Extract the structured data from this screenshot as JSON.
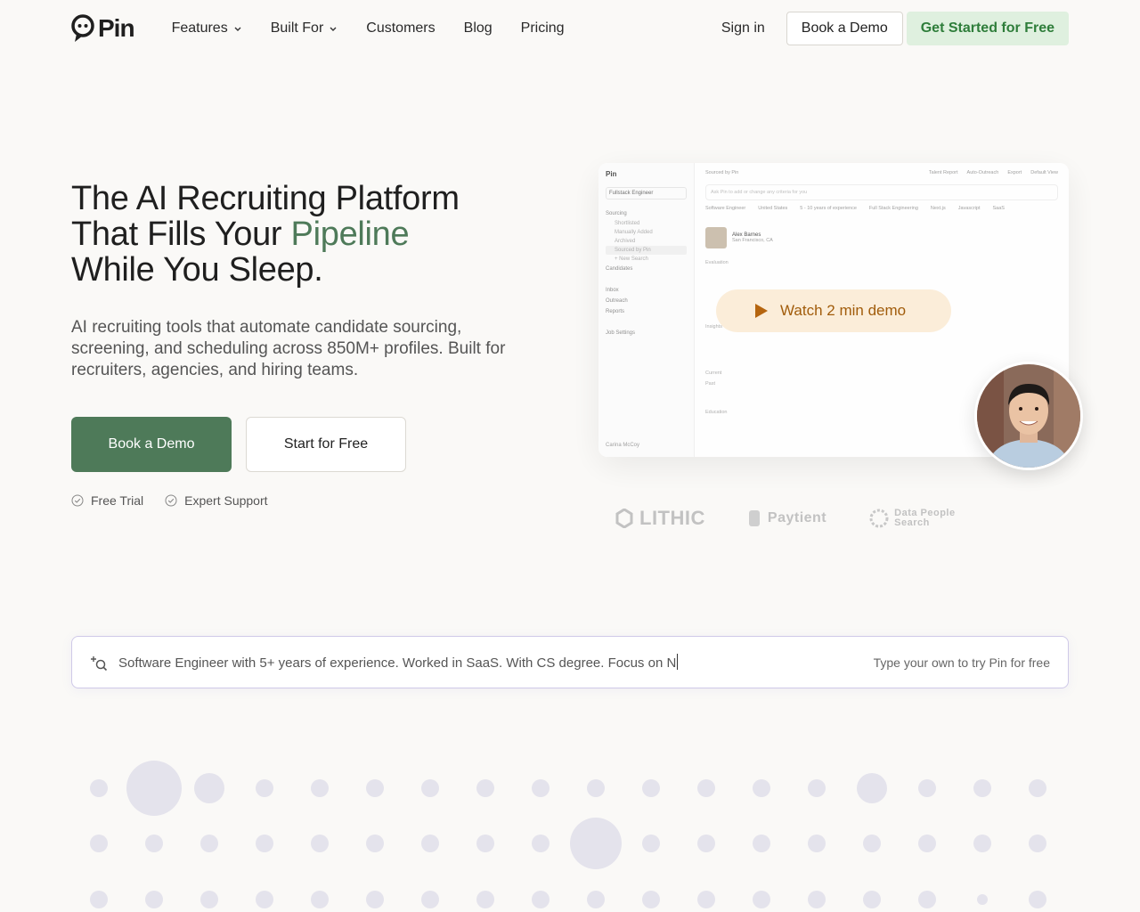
{
  "nav": {
    "logo_text": "Pin",
    "links": [
      "Features",
      "Built For",
      "Customers",
      "Blog",
      "Pricing"
    ],
    "sign_in": "Sign in",
    "book_demo": "Book a Demo",
    "get_started": "Get Started for Free"
  },
  "hero": {
    "title_line1": "The AI Recruiting Platform",
    "title_line2_pre": "That Fills Your ",
    "title_line2_accent": "Pipeline",
    "title_line3": "While You Sleep.",
    "subtitle": "AI recruiting tools that automate candidate sourcing, screening, and scheduling across 850M+ profiles. Built for recruiters, agencies, and hiring teams.",
    "cta_primary": "Book a Demo",
    "cta_secondary": "Start for Free",
    "perks": [
      "Free Trial",
      "Expert Support"
    ]
  },
  "preview": {
    "brand": "Pin",
    "job": "Fullstack Engineer",
    "side_items": [
      "Sourcing",
      "Shortlisted",
      "Manually Added",
      "Archived",
      "Sourced by Pin",
      "+ New Search",
      "Candidates",
      "Inbox",
      "Outreach",
      "Reports",
      "Job Settings"
    ],
    "side_footer": "Carina McCoy",
    "header_left": "Sourced by Pin",
    "header_right": [
      "Talent Report",
      "Auto-Outreach",
      "Export",
      "Default View"
    ],
    "prompt": "Ask Pin to add or change any criteria for you",
    "tags": [
      "Software Engineer",
      "United States",
      "5 - 10 years of experience",
      "Full Stack Engineering",
      "Next.js",
      "Javascript",
      "SaaS"
    ],
    "candidate_name": "Alex Barnes",
    "candidate_loc": "San Francisco, CA",
    "rows": [
      "Evaluation",
      "Insights",
      "Current",
      "Past",
      "Education"
    ],
    "watch_label": "Watch 2 min demo"
  },
  "logos": [
    "LITHIC",
    "Paytient",
    "Data People Search"
  ],
  "search": {
    "text": "Software Engineer with 5+ years of experience. Worked in SaaS. With CS degree. Focus on N",
    "hint": "Type your own to try Pin for free"
  },
  "colors": {
    "accent_green": "#4e7a59",
    "watch_bg": "#fbecd6",
    "watch_text": "#a15c0b",
    "dot": "#e4e3ec"
  }
}
